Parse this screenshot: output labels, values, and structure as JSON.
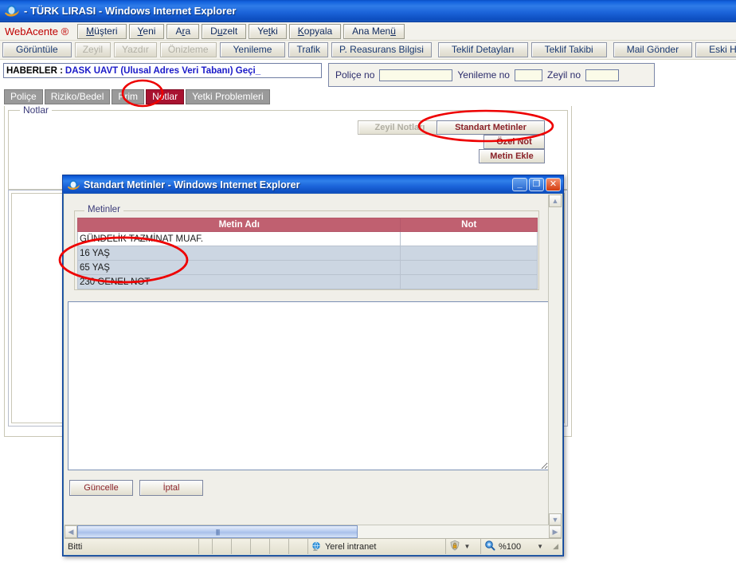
{
  "window": {
    "title": "- TÜRK LIRASI - Windows Internet Explorer",
    "icon": "ie-logo-icon"
  },
  "menustrip": {
    "brand": "WebAcente ®",
    "items": [
      {
        "label": "Müşteri",
        "accel": "M"
      },
      {
        "label": "Yeni",
        "accel": "Y"
      },
      {
        "label": "Ara",
        "accel": "r"
      },
      {
        "label": "Duzelt",
        "accel": "u"
      },
      {
        "label": "Yetki",
        "accel": "t"
      },
      {
        "label": "Kopyala",
        "accel": "K"
      },
      {
        "label": "Ana Menü",
        "accel": "ü"
      }
    ]
  },
  "toolbar": {
    "buttons": [
      {
        "label": "Görüntüle",
        "disabled": false
      },
      {
        "label": "Zeyil",
        "disabled": true
      },
      {
        "label": "Yazdır",
        "disabled": true
      },
      {
        "label": "Önizleme",
        "disabled": true
      },
      {
        "label": "Yenileme",
        "disabled": false
      },
      {
        "label": "Trafik",
        "disabled": false
      },
      {
        "label": "P. Reasurans Bilgisi",
        "disabled": false
      },
      {
        "label": "Teklif Detayları",
        "disabled": false
      },
      {
        "label": "Teklif Takibi",
        "disabled": false
      },
      {
        "label": "Mail Gönder",
        "disabled": false
      },
      {
        "label": "Eski Hasar",
        "disabled": false
      }
    ]
  },
  "news": {
    "label": "HABERLER :",
    "text": "DASK UAVT (Ulusal Adres Veri Tabanı) Geçi_"
  },
  "policy": {
    "police_no_label": "Poliçe no",
    "police_no_value": "",
    "yenileme_no_label": "Yenileme no",
    "yenileme_no_value": "",
    "zeyil_no_label": "Zeyil no",
    "zeyil_no_value": ""
  },
  "tabs": [
    {
      "label": "Poliçe",
      "active": false
    },
    {
      "label": "Riziko/Bedel",
      "active": false
    },
    {
      "label": "Prim",
      "active": false
    },
    {
      "label": "Notlar",
      "active": true
    },
    {
      "label": "Yetki Problemleri",
      "active": false
    }
  ],
  "notlar_panel": {
    "legend": "Notlar",
    "buttons": [
      {
        "label": "Zeyil Notları",
        "disabled": true
      },
      {
        "label": "Standart Metinler",
        "disabled": false
      },
      {
        "label": "Özel Not",
        "disabled": false
      },
      {
        "label": "Metin Ekle",
        "disabled": false
      }
    ]
  },
  "dialog": {
    "title": "Standart Metinler - Windows Internet Explorer",
    "icon": "ie-logo-icon",
    "window_buttons": [
      {
        "name": "minimize",
        "glyph": "_"
      },
      {
        "name": "maximize",
        "glyph": "❐"
      },
      {
        "name": "close",
        "glyph": "✕"
      }
    ],
    "group_legend": "Metinler",
    "table": {
      "columns": [
        "Metin Adı",
        "Not"
      ],
      "rows": [
        {
          "metin_adi": "GÜNDELİK TAZMİNAT MUAF.",
          "not": "",
          "style": "white"
        },
        {
          "metin_adi": "16 YAŞ",
          "not": "",
          "style": "blue"
        },
        {
          "metin_adi": "65 YAŞ",
          "not": "",
          "style": "blue"
        },
        {
          "metin_adi": "230 GENEL NOT",
          "not": "",
          "style": "blue"
        }
      ]
    },
    "note_text": "",
    "actions": [
      {
        "label": "Güncelle"
      },
      {
        "label": "İptal"
      }
    ],
    "statusbar": {
      "status": "Bitti",
      "zone": "Yerel intranet",
      "zoom": "%100"
    }
  },
  "colors": {
    "titlebar_blue": "#1362de",
    "brand_red": "#c00000",
    "active_tab_red": "#a81230",
    "table_header_red": "#c06070",
    "button_text_red": "#8a2128",
    "news_text_blue": "#1919c8",
    "annotation_red": "#ee0000"
  }
}
